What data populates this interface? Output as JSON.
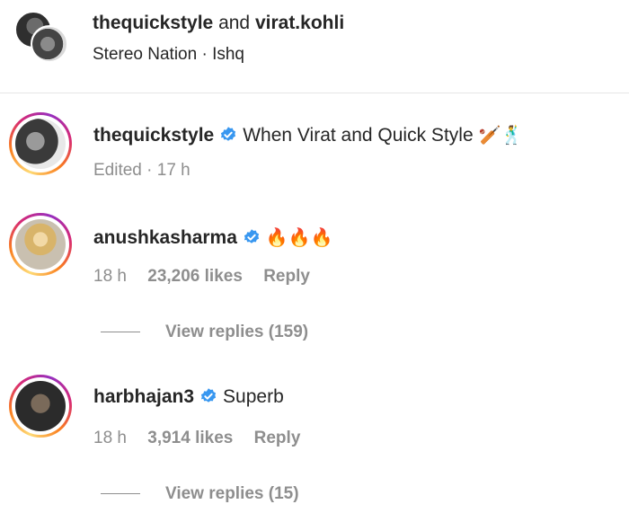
{
  "header": {
    "user1": "thequickstyle",
    "and": "and",
    "user2": "virat.kohli",
    "audio": "Stereo Nation · Ishq"
  },
  "comments": [
    {
      "username": "thequickstyle",
      "verified": true,
      "text": "When Virat and Quick Style",
      "emoji": "🏏🕺",
      "meta": {
        "edited": "Edited · 17 h"
      }
    },
    {
      "username": "anushkasharma",
      "verified": true,
      "text": "🔥🔥🔥",
      "meta": {
        "time": "18 h",
        "likes": "23,206 likes",
        "reply": "Reply"
      },
      "view_replies": "View replies (159)"
    },
    {
      "username": "harbhajan3",
      "verified": true,
      "text": "Superb",
      "meta": {
        "time": "18 h",
        "likes": "3,914 likes",
        "reply": "Reply"
      },
      "view_replies": "View replies (15)"
    }
  ],
  "colors": {
    "text": "#262626",
    "secondary": "#8e8e8e",
    "verified": "#3897f0",
    "divider": "#e6e6e6"
  }
}
